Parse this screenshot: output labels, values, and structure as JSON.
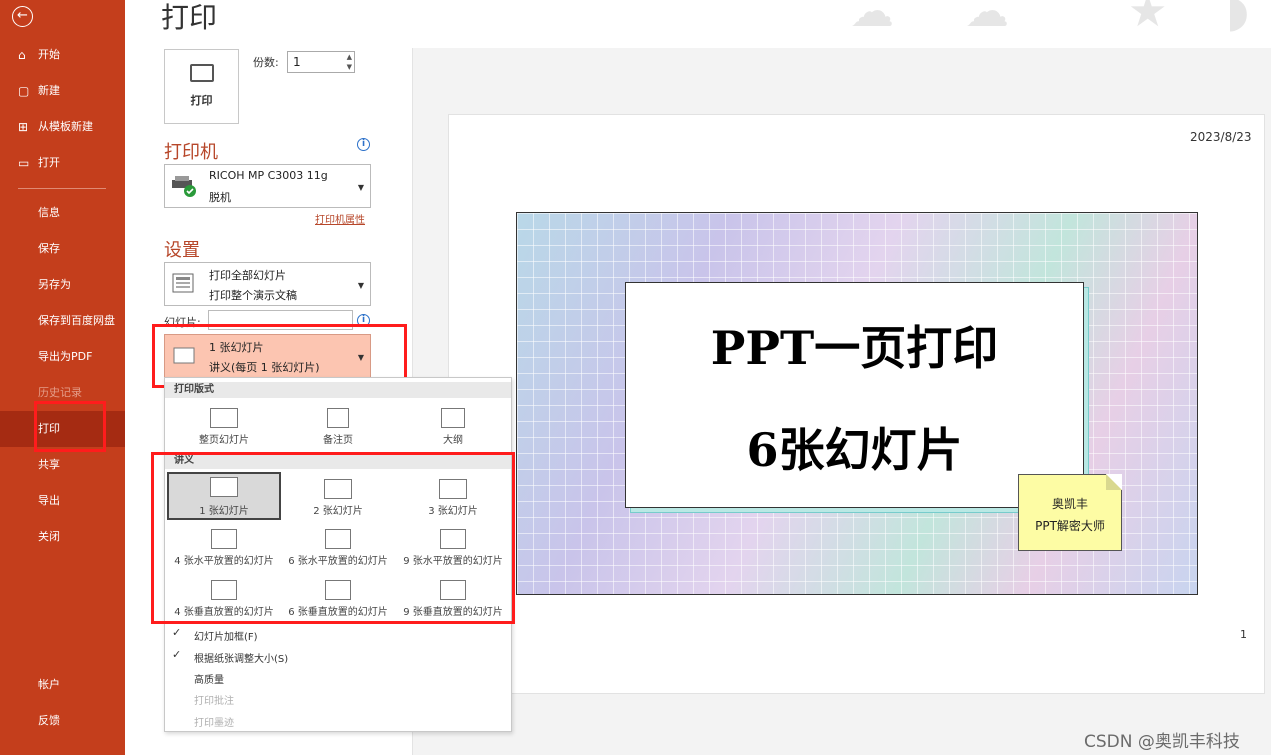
{
  "sidebar": {
    "back_icon": "back-arrow-icon",
    "items": [
      {
        "label": "开始",
        "icon": "⌂"
      },
      {
        "label": "新建",
        "icon": "▢"
      },
      {
        "label": "从模板新建",
        "icon": "⊞"
      },
      {
        "label": "打开",
        "icon": "▭"
      },
      {
        "label": "信息"
      },
      {
        "label": "保存"
      },
      {
        "label": "另存为"
      },
      {
        "label": "保存到百度网盘"
      },
      {
        "label": "导出为PDF"
      },
      {
        "label": "历史记录"
      },
      {
        "label": "打印"
      },
      {
        "label": "共享"
      },
      {
        "label": "导出"
      },
      {
        "label": "关闭"
      },
      {
        "label": "帐户"
      },
      {
        "label": "反馈"
      }
    ]
  },
  "page_title": "打印",
  "print_button": {
    "label": "打印"
  },
  "copies": {
    "label": "份数:",
    "value": "1"
  },
  "printer": {
    "section_title": "打印机",
    "name": "RICOH MP C3003 11g",
    "status": "脱机",
    "properties_link": "打印机属性"
  },
  "settings": {
    "section_title": "设置",
    "range": {
      "line1": "打印全部幻灯片",
      "line2": "打印整个演示文稿"
    },
    "slides_label": "幻灯片:",
    "slides_value": "",
    "layout": {
      "line1": "1 张幻灯片",
      "line2": "讲义(每页 1 张幻灯片)"
    }
  },
  "layout_menu": {
    "print_layout_header": "打印版式",
    "print_layout_options": [
      "整页幻灯片",
      "备注页",
      "大纲"
    ],
    "handouts_header": "讲义",
    "handout_options": [
      "1 张幻灯片",
      "2 张幻灯片",
      "3 张幻灯片",
      "4 张水平放置的幻灯片",
      "6 张水平放置的幻灯片",
      "9 张水平放置的幻灯片",
      "4 张垂直放置的幻灯片",
      "6 张垂直放置的幻灯片",
      "9 张垂直放置的幻灯片"
    ],
    "checks": [
      {
        "label": "幻灯片加框(F)",
        "checked": true,
        "enabled": true
      },
      {
        "label": "根据纸张调整大小(S)",
        "checked": true,
        "enabled": true
      },
      {
        "label": "高质量",
        "checked": false,
        "enabled": true
      },
      {
        "label": "打印批注",
        "checked": false,
        "enabled": false
      },
      {
        "label": "打印墨迹",
        "checked": false,
        "enabled": false
      }
    ]
  },
  "preview": {
    "date": "2023/8/23",
    "page_number": "1",
    "slide_title_line1": "PPT一页打印",
    "slide_title_line2": "6张幻灯片",
    "note_line1": "奥凯丰",
    "note_line2": "PPT解密大师"
  },
  "watermark": "CSDN @奥凯丰科技",
  "colors": {
    "sidebar": "#c43e1c",
    "accent": "#b7472a",
    "highlight": "#fcc5b1",
    "annotation": "#ff1c1c"
  }
}
